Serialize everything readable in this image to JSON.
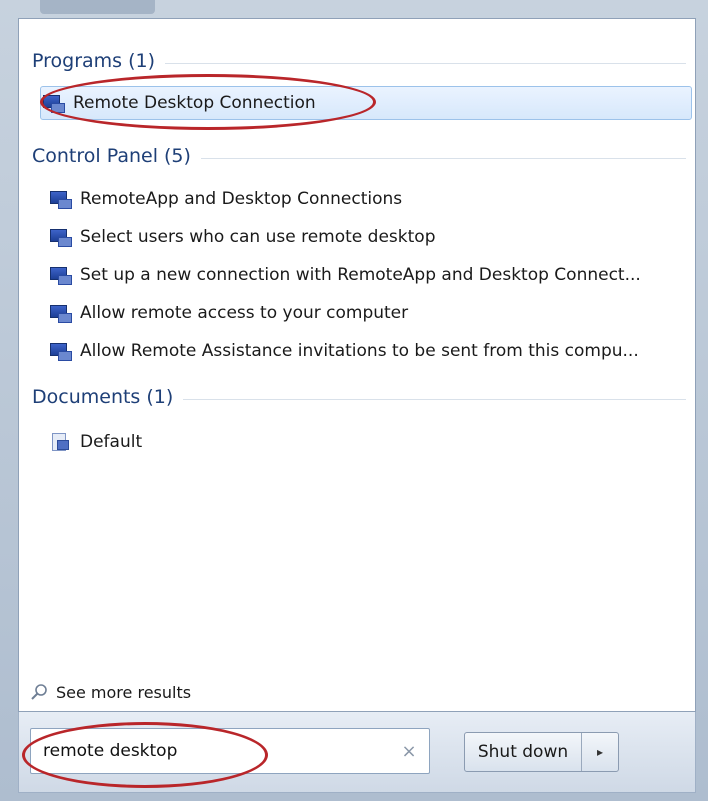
{
  "groups": {
    "programs": {
      "title": "Programs (1)",
      "items": [
        {
          "label": "Remote Desktop Connection",
          "icon": "remote-desktop-icon"
        }
      ]
    },
    "control_panel": {
      "title": "Control Panel (5)",
      "items": [
        {
          "label": "RemoteApp and Desktop Connections",
          "icon": "remoteapp-icon"
        },
        {
          "label": "Select users who can use remote desktop",
          "icon": "system-icon"
        },
        {
          "label": "Set up a new connection with RemoteApp and Desktop Connect...",
          "icon": "remoteapp-icon"
        },
        {
          "label": "Allow remote access to your computer",
          "icon": "system-icon"
        },
        {
          "label": "Allow Remote Assistance invitations to be sent from this compu...",
          "icon": "system-icon"
        }
      ]
    },
    "documents": {
      "title": "Documents (1)",
      "items": [
        {
          "label": "Default",
          "icon": "document-icon"
        }
      ]
    }
  },
  "see_more": {
    "label": "See more results",
    "icon": "search-icon"
  },
  "search": {
    "value": "remote desktop",
    "clear_icon": "×"
  },
  "shutdown": {
    "label": "Shut down",
    "arrow": "▸"
  },
  "colors": {
    "annotation": "#b9262a",
    "header_text": "#1e3f77"
  }
}
